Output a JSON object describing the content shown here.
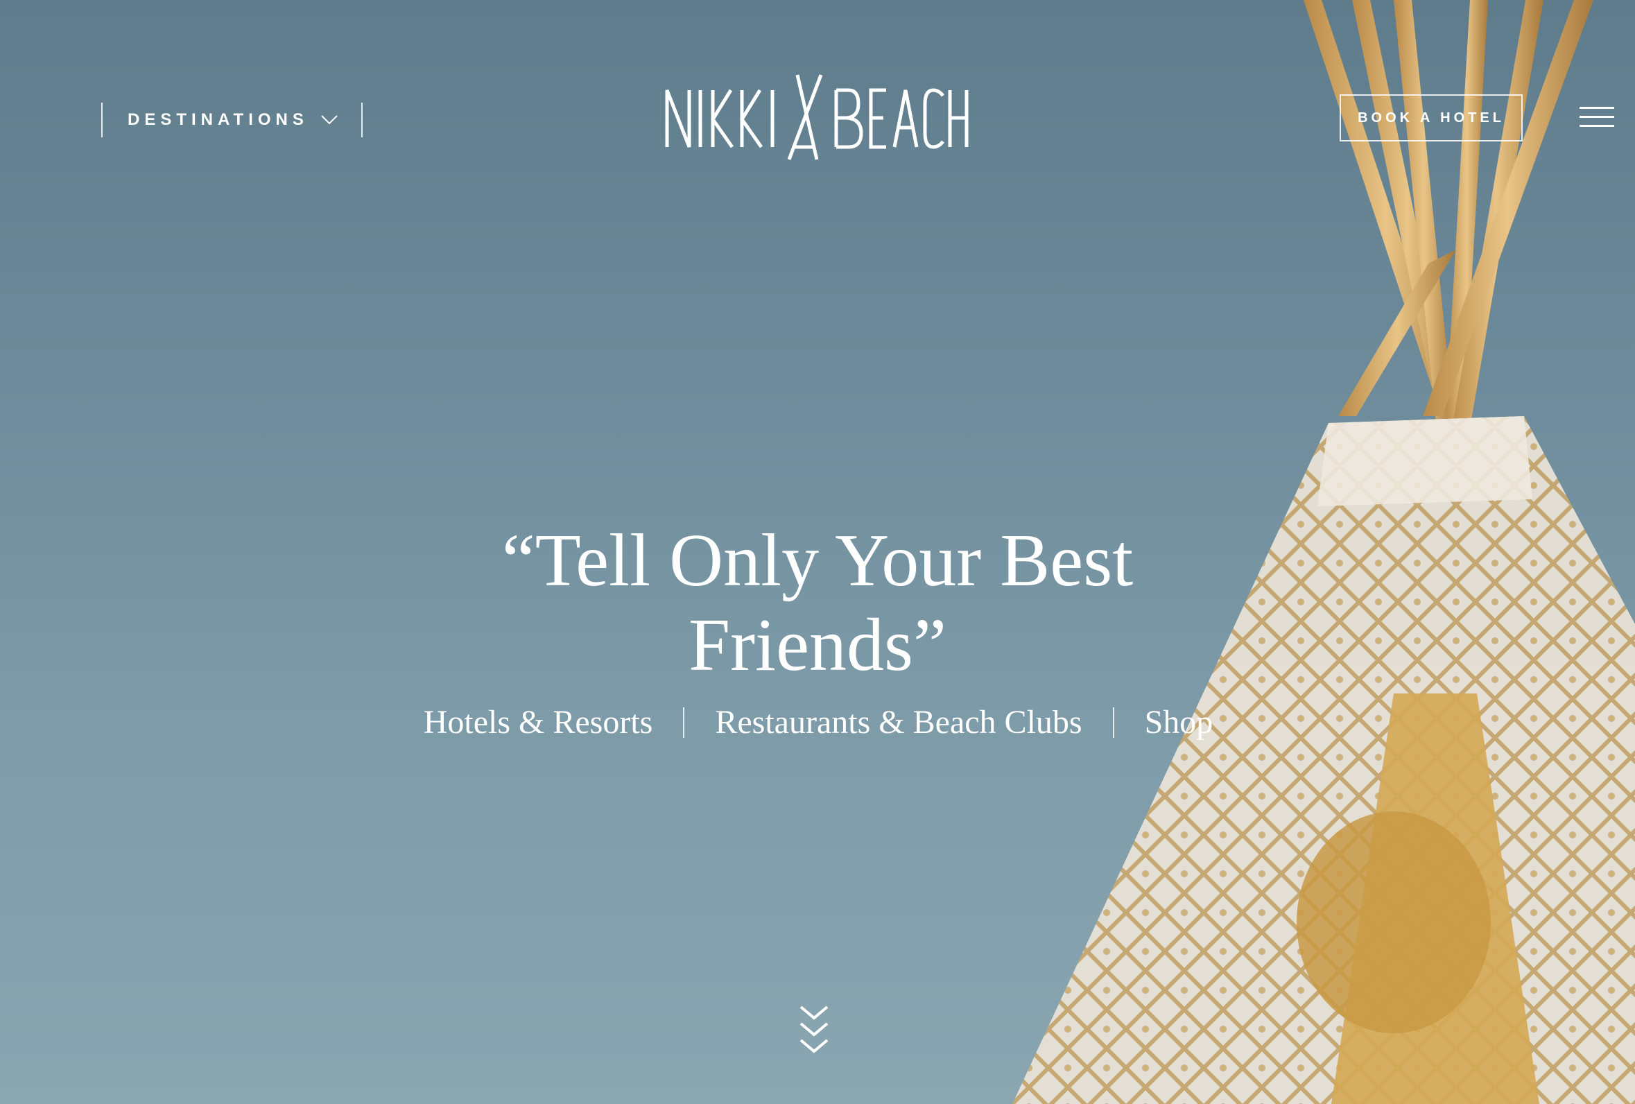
{
  "header": {
    "destinations_label": "DESTINATIONS",
    "logo_text": "NIKKI BEACH",
    "book_label": "BOOK A HOTEL"
  },
  "hero": {
    "headline": "“Tell Only Your Best Friends”",
    "links": [
      {
        "label": "Hotels & Resorts"
      },
      {
        "label": "Restaurants & Beach Clubs"
      },
      {
        "label": "Shop"
      }
    ]
  },
  "icons": {
    "destinations_chevron": "chevron-down-icon",
    "menu": "hamburger-menu-icon",
    "scroll": "triple-chevron-down-icon"
  },
  "colors": {
    "sky_top": "#5f7c8c",
    "sky_bottom": "#8aa6b1",
    "text": "#ffffff"
  }
}
